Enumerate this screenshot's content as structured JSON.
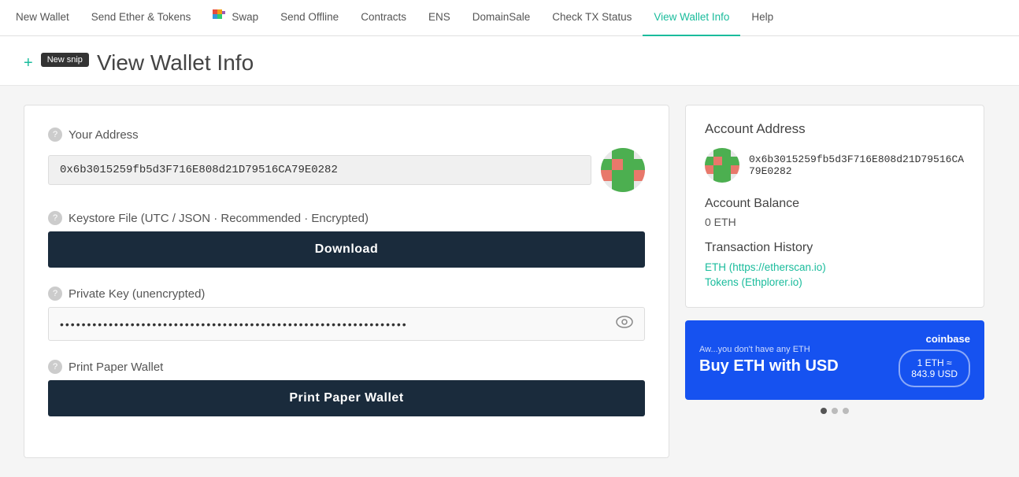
{
  "nav": {
    "items": [
      {
        "label": "New Wallet",
        "id": "new-wallet",
        "active": false
      },
      {
        "label": "Send Ether & Tokens",
        "id": "send-ether",
        "active": false
      },
      {
        "label": "Swap",
        "id": "swap",
        "active": false,
        "hasIcon": true
      },
      {
        "label": "Send Offline",
        "id": "send-offline",
        "active": false
      },
      {
        "label": "Contracts",
        "id": "contracts",
        "active": false
      },
      {
        "label": "ENS",
        "id": "ens",
        "active": false
      },
      {
        "label": "DomainSale",
        "id": "domain-sale",
        "active": false
      },
      {
        "label": "Check TX Status",
        "id": "check-tx",
        "active": false
      },
      {
        "label": "View Wallet Info",
        "id": "view-wallet",
        "active": true
      },
      {
        "label": "Help",
        "id": "help",
        "active": false
      }
    ]
  },
  "page": {
    "plus_label": "+",
    "title": "View Wallet Info",
    "tooltip": "New snip"
  },
  "left_panel": {
    "your_address_label": "Your Address",
    "address_value": "0x6b3015259fb5d3F716E808d21D79516CA79E0282",
    "keystore_label": "Keystore File (UTC / JSON · Recommended · Encrypted)",
    "download_btn": "Download",
    "private_key_label": "Private Key (unencrypted)",
    "private_key_dots": "••••••••••••••••••••••••••••••••••••••••••••••••••••••••••••••••",
    "print_label": "Print Paper Wallet",
    "print_btn": "Print Paper Wallet"
  },
  "right_panel": {
    "account_address_title": "Account Address",
    "account_address": "0x6b3015259fb5d3F716E808d21D79516CA79E0282",
    "account_balance_title": "Account Balance",
    "account_balance": "0 ETH",
    "tx_history_title": "Transaction History",
    "tx_eth_link": "ETH (https://etherscan.io)",
    "tx_tokens_link": "Tokens (Ethplorer.io)",
    "banner": {
      "label": "Aw...you don't have any ETH",
      "brand": "coinbase",
      "cta": "Buy ETH with USD",
      "rate_line1": "1 ETH ≈",
      "rate_line2": "843.9 USD"
    }
  }
}
